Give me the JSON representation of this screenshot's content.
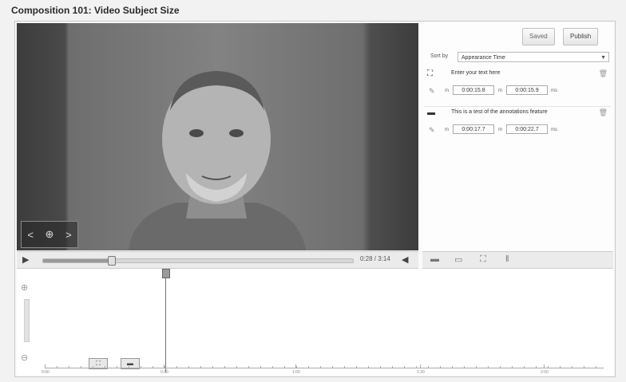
{
  "page": {
    "title": "Composition 101: Video Subject Size"
  },
  "player": {
    "prev_glyph": "<",
    "center_glyph": "⊕",
    "next_glyph": ">",
    "play_glyph": "▶",
    "time": "0:28 / 3:14",
    "volume_glyph": "◀",
    "progress_fraction": 0.22
  },
  "editor": {
    "save_label": "Saved",
    "publish_label": "Publish",
    "sort_label": "Sort by",
    "sort_value": "Appearance Time",
    "annotations": [
      {
        "type_icon": "spotlight-icon",
        "text": "Enter your text here",
        "start": "0:00:15.8",
        "end": "0:00:15.9",
        "from_label": "m",
        "to_label": "m",
        "end_unit": "ms"
      },
      {
        "type_icon": "speech-bubble-icon",
        "text": "This is a test of the annotations feature",
        "start": "0:00:17.7",
        "end": "0:00:22.7",
        "from_label": "m",
        "to_label": "m",
        "end_unit": "ms"
      }
    ]
  },
  "timeline": {
    "ticks": [
      "0:00",
      "0:20",
      "1:00",
      "1:30",
      "2:00"
    ]
  },
  "colors": {
    "accent": "#777777",
    "panel_bg": "#ebebeb"
  }
}
